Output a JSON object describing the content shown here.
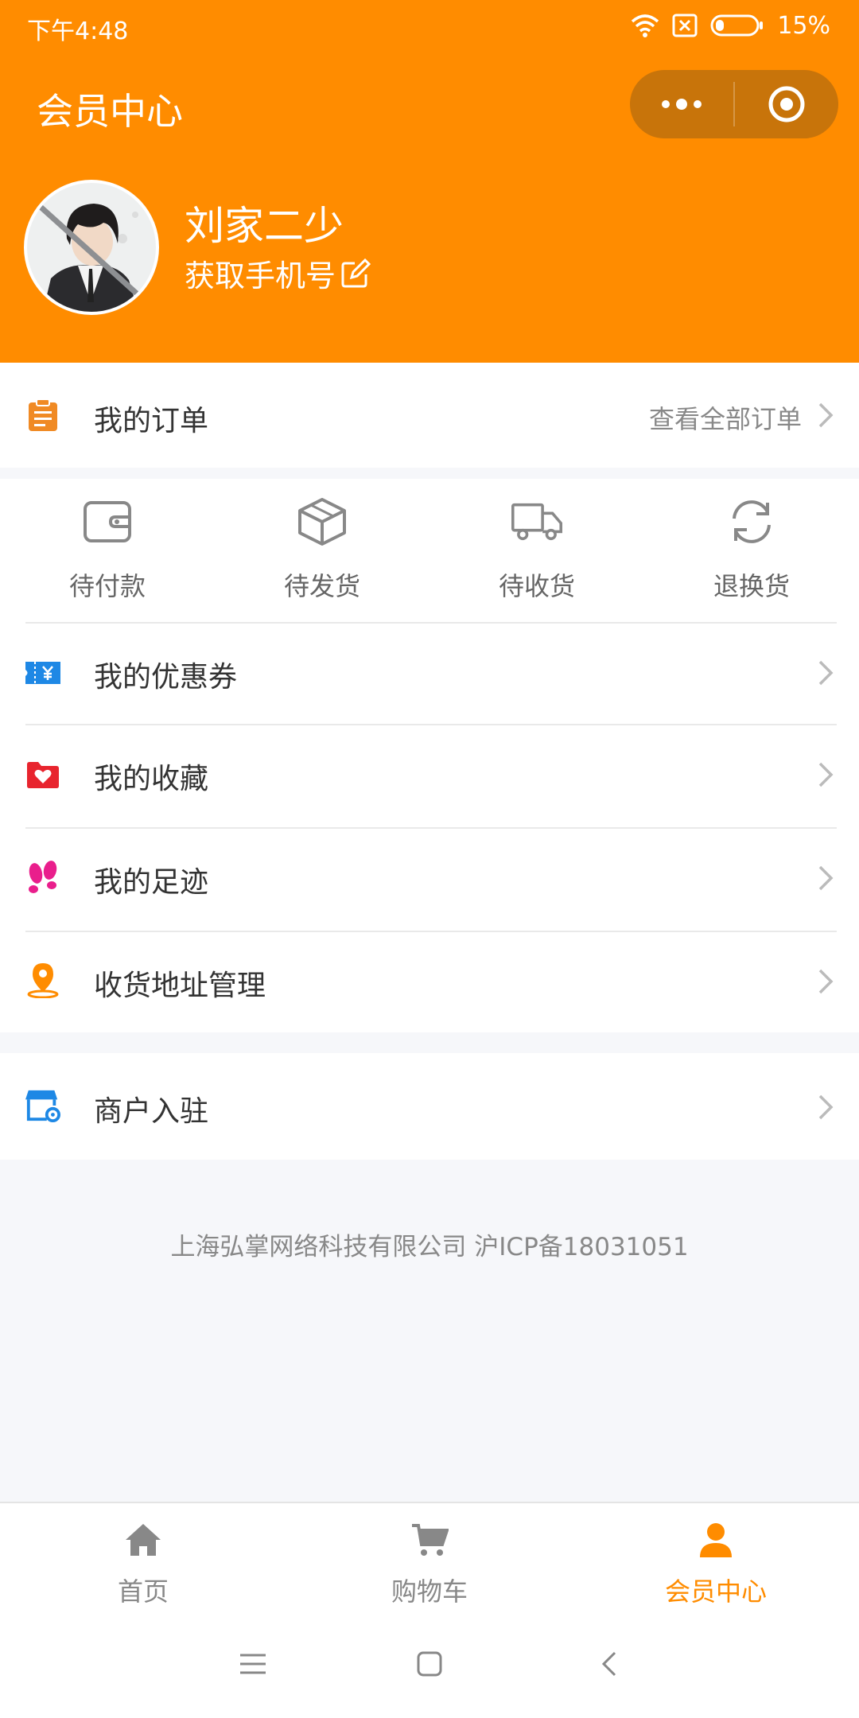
{
  "status_bar": {
    "time": "下午4:48",
    "battery": "15%"
  },
  "header": {
    "title": "会员中心"
  },
  "profile": {
    "name": "刘家二少",
    "phone_link": "获取手机号"
  },
  "orders": {
    "title": "我的订单",
    "view_all": "查看全部订单",
    "statuses": [
      {
        "label": "待付款",
        "icon": "wallet-icon"
      },
      {
        "label": "待发货",
        "icon": "box-icon"
      },
      {
        "label": "待收货",
        "icon": "truck-icon"
      },
      {
        "label": "退换货",
        "icon": "refresh-icon"
      }
    ]
  },
  "menu": [
    {
      "label": "我的优惠券",
      "icon": "coupon-icon",
      "color": "#1e88e5"
    },
    {
      "label": "我的收藏",
      "icon": "favorite-folder-icon",
      "color": "#e8242e"
    },
    {
      "label": "我的足迹",
      "icon": "footprints-icon",
      "color": "#e91e8c"
    },
    {
      "label": "收货地址管理",
      "icon": "location-pin-icon",
      "color": "#ff8c00"
    }
  ],
  "merchant": {
    "label": "商户入驻",
    "icon": "store-settings-icon",
    "color": "#1e88e5"
  },
  "footer": {
    "text": "上海弘掌网络科技有限公司 沪ICP备18031051"
  },
  "tabbar": {
    "items": [
      {
        "label": "首页",
        "icon": "home-icon"
      },
      {
        "label": "购物车",
        "icon": "cart-icon"
      },
      {
        "label": "会员中心",
        "icon": "user-icon",
        "active": true
      }
    ]
  },
  "colors": {
    "brand": "#ff8c00",
    "capsule": "#c8740a"
  }
}
